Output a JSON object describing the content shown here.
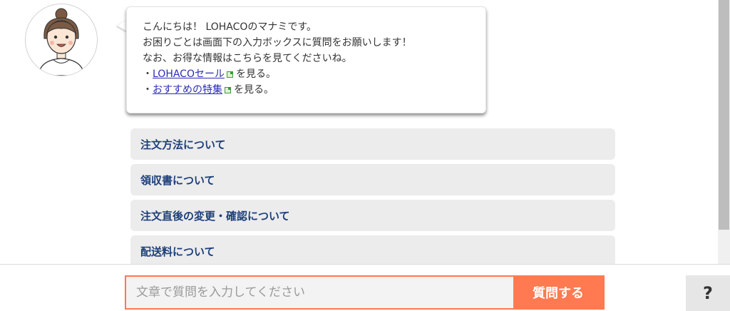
{
  "greeting": {
    "line1": "こんにちは！ LOHACOのマナミです。",
    "line2": "お困りごとは画面下の入力ボックスに質問をお願いします！",
    "line3": "なお、お得な情報はこちらを見てくださいね。",
    "bullet": "・",
    "link1_label": "LOHACOセール",
    "link2_label": "おすすめの特集",
    "link_suffix": "を見る。"
  },
  "faq": {
    "items": [
      {
        "label": "注文方法について"
      },
      {
        "label": "領収書について"
      },
      {
        "label": "注文直後の変更・確認について"
      },
      {
        "label": "配送料について"
      }
    ]
  },
  "input": {
    "placeholder": "文章で質問を入力してください",
    "value": ""
  },
  "submit": {
    "label": "質問する"
  },
  "help": {
    "label": "?"
  },
  "icons": {
    "avatar": "operator-avatar-icon",
    "external": "external-link-icon"
  },
  "colors": {
    "accent": "#ff7a50",
    "faq_text": "#1d3f7a",
    "faq_bg": "#ececec",
    "link": "#2b2bb5"
  }
}
